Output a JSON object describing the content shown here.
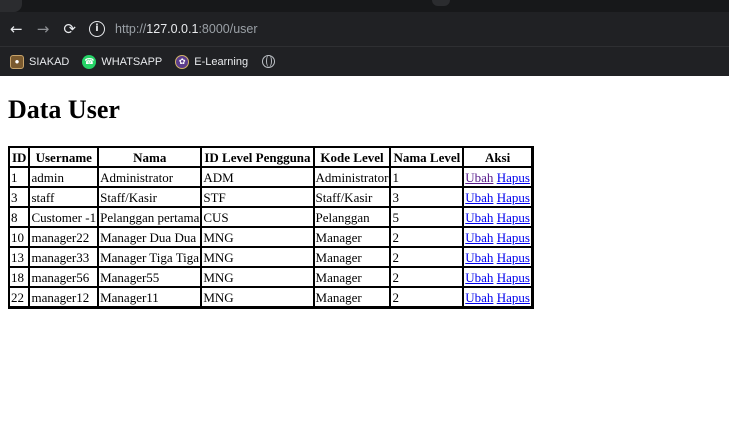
{
  "browser": {
    "url": {
      "scheme": "http://",
      "host": "127.0.0.1",
      "path": ":8000/user"
    },
    "bookmarks": [
      {
        "label": "SIAKAD"
      },
      {
        "label": "WHATSAPP"
      },
      {
        "label": "E-Learning"
      }
    ]
  },
  "page": {
    "title": "Data User"
  },
  "table": {
    "headers": [
      "ID",
      "Username",
      "Nama",
      "ID Level Pengguna",
      "Kode Level",
      "Nama Level",
      "Aksi"
    ],
    "action_labels": {
      "edit": "Ubah",
      "delete": "Hapus"
    },
    "rows": [
      [
        "1",
        "admin",
        "Administrator",
        "ADM",
        "Administrator",
        "1"
      ],
      [
        "3",
        "staff",
        "Staff/Kasir",
        "STF",
        "Staff/Kasir",
        "3"
      ],
      [
        "8",
        "Customer -1",
        "Pelanggan pertama",
        "CUS",
        "Pelanggan",
        "5"
      ],
      [
        "10",
        "manager22",
        "Manager Dua Dua",
        "MNG",
        "Manager",
        "2"
      ],
      [
        "13",
        "manager33",
        "Manager Tiga Tiga",
        "MNG",
        "Manager",
        "2"
      ],
      [
        "18",
        "manager56",
        "Manager55",
        "MNG",
        "Manager",
        "2"
      ],
      [
        "22",
        "manager12",
        "Manager11",
        "MNG",
        "Manager",
        "2"
      ]
    ]
  }
}
